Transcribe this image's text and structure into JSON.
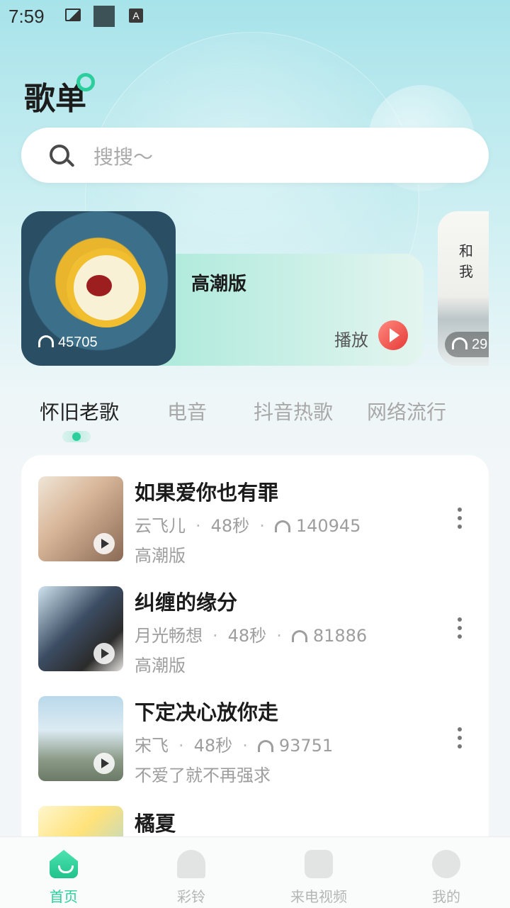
{
  "status_bar": {
    "time": "7:59",
    "icons": [
      "image-icon",
      "square-icon",
      "a-icon"
    ],
    "a_glyph": "A"
  },
  "header": {
    "title": "歌单"
  },
  "search": {
    "placeholder": "搜搜～"
  },
  "featured": [
    {
      "title": "高潮版",
      "listens": "45705",
      "play_label": "播放"
    },
    {
      "cover_text": "和 我",
      "listens": "29"
    }
  ],
  "tabs": [
    {
      "label": "怀旧老歌",
      "active": true
    },
    {
      "label": "电音",
      "active": false
    },
    {
      "label": "抖音热歌",
      "active": false
    },
    {
      "label": "网络流行",
      "active": false
    }
  ],
  "songs": [
    {
      "title": "如果爱你也有罪",
      "artist": "云飞儿",
      "duration": "48秒",
      "listens": "140945",
      "subtitle": "高潮版"
    },
    {
      "title": "纠缠的缘分",
      "artist": "月光畅想",
      "duration": "48秒",
      "listens": "81886",
      "subtitle": "高潮版"
    },
    {
      "title": "下定决心放你走",
      "artist": "宋飞",
      "duration": "48秒",
      "listens": "93751",
      "subtitle": "不爱了就不再强求"
    },
    {
      "title": "橘夏"
    }
  ],
  "nav": [
    {
      "label": "首页",
      "icon": "home-icon",
      "active": true
    },
    {
      "label": "彩铃",
      "icon": "bell-icon",
      "active": false
    },
    {
      "label": "来电视频",
      "icon": "phone-video-icon",
      "active": false
    },
    {
      "label": "我的",
      "icon": "profile-icon",
      "active": false
    }
  ],
  "colors": {
    "accent": "#2ccf9c",
    "play_red": "#e53935"
  }
}
